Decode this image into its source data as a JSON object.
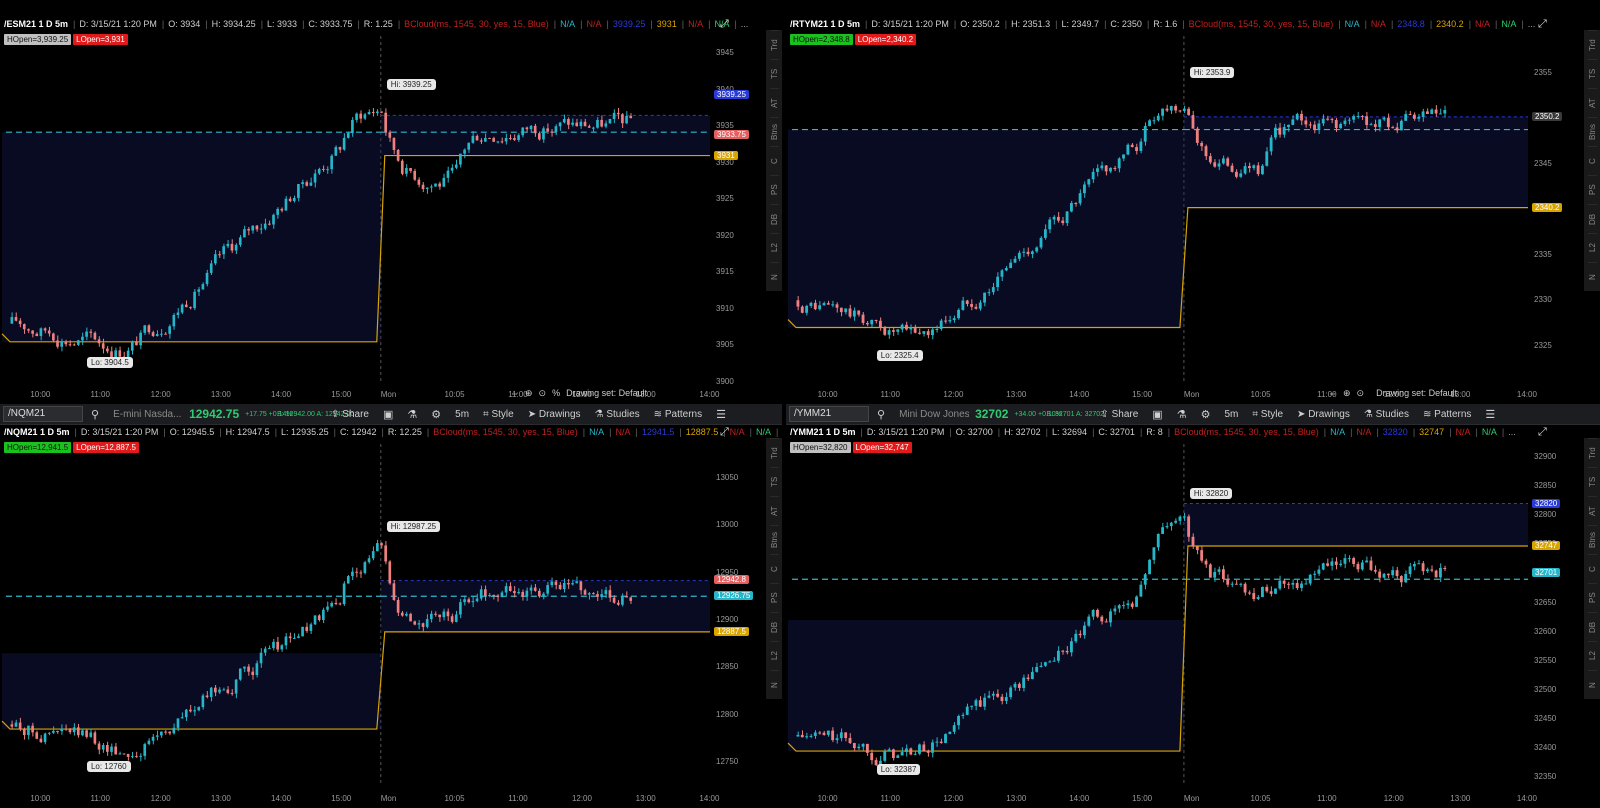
{
  "top_strip": {
    "color": "#ffffff"
  },
  "charts": [
    {
      "id": "es",
      "toolbar": null,
      "header": {
        "title": "/ESM21 1 D 5m",
        "date": "D: 3/15/21 1:20 PM",
        "o": "O: 3934",
        "h": "H: 3934.25",
        "l": "L: 3933",
        "c": "C: 3933.75",
        "r": "R: 1.25",
        "extra": [
          "BCloud(ms, 1545, 30, yes, 15, Blue)",
          "N/A",
          "N/A",
          "3939.25",
          "3931",
          "N/A",
          "N/A",
          "..."
        ]
      },
      "badges": [
        {
          "text": "HOpen=3,939.25",
          "bg": "#c0c0c0",
          "fg": "#111"
        },
        {
          "text": "LOpen=3,931",
          "bg": "#e01a1a",
          "fg": "#fff"
        }
      ],
      "y_labels": [
        "3945",
        "3940",
        "3935",
        "3930",
        "3925",
        "3920",
        "3915",
        "3910",
        "3905",
        "3900"
      ],
      "ymin": 3900,
      "ymax": 3946,
      "tags": [
        {
          "text": "3939.25",
          "value": 3939.25,
          "bg": "#2a3ad6"
        },
        {
          "text": "3933.75",
          "value": 3933.75,
          "bg": "#e46060"
        },
        {
          "text": "3931",
          "value": 3931,
          "bg": "#d8a400"
        }
      ],
      "x_labels": [
        "10:00",
        "11:00",
        "12:00",
        "13:00",
        "14:00",
        "15:00",
        "Mon",
        "10:05",
        "11:00",
        "12:00",
        "13:00",
        "14:00"
      ],
      "hi_label": "Hi: 3939.25",
      "lo_label": "Lo: 3904.5",
      "controls": {
        "drawing_set": "Drawing set: Default",
        "pct": "%"
      },
      "series": {
        "start": 3908,
        "hiVal": 3939.25,
        "loVal": 3904.5,
        "levels": {
          "dashA": 3936.5,
          "dashB": 3934.2,
          "gold": 3931,
          "goldPrev": 3905.5
        }
      }
    },
    {
      "id": "rty",
      "toolbar": null,
      "header": {
        "title": "/RTYM21 1 D 5m",
        "date": "D: 3/15/21 1:20 PM",
        "o": "O: 2350.2",
        "h": "H: 2351.3",
        "l": "L: 2349.7",
        "c": "C: 2350",
        "r": "R: 1.6",
        "extra": [
          "BCloud(ms, 1545, 30, yes, 15, Blue)",
          "N/A",
          "N/A",
          "2348.8",
          "2340.2",
          "N/A",
          "N/A",
          "..."
        ]
      },
      "badges": [
        {
          "text": "HOpen=2,348.8",
          "bg": "#19c21c",
          "fg": "#111"
        },
        {
          "text": "LOpen=2,340.2",
          "bg": "#e01a1a",
          "fg": "#fff"
        }
      ],
      "y_labels": [
        "2355",
        "2350",
        "2345",
        "2340",
        "2335",
        "2330",
        "2325"
      ],
      "ymin": 2321,
      "ymax": 2358,
      "tags": [
        {
          "text": "2350.2",
          "value": 2350.2,
          "bg": "#3a3a3a"
        },
        {
          "text": "2340.2",
          "value": 2340.2,
          "bg": "#d8a400"
        }
      ],
      "x_labels": [
        "10:00",
        "11:00",
        "12:00",
        "13:00",
        "14:00",
        "15:00",
        "Mon",
        "10:05",
        "11:00",
        "12:00",
        "13:00",
        "14:00"
      ],
      "hi_label": "Hi: 2353.9",
      "lo_label": "Lo: 2325.4",
      "controls": {
        "drawing_set": "Drawing set: Default",
        "pct": ""
      },
      "series": {
        "start": 2330,
        "hiVal": 2353.9,
        "loVal": 2325.4,
        "levels": {
          "dashA": 2350.2,
          "dashB": 2348.8,
          "gold": 2340.2,
          "goldPrev": 2327
        }
      }
    },
    {
      "id": "nq",
      "toolbar": {
        "symbol": "/NQM21",
        "desc": "E-mini Nasda...",
        "price": "12942.75",
        "chg": "+17.75 +0.14%",
        "bidask": "B: 12942.00 A: 12942.00",
        "share": "Share",
        "interval": "5m",
        "style": "Style",
        "drawings": "Drawings",
        "studies": "Studies",
        "patterns": "Patterns"
      },
      "header": {
        "title": "/NQM21 1 D 5m",
        "date": "D: 3/15/21 1:20 PM",
        "o": "O: 12945.5",
        "h": "H: 12947.5",
        "l": "L: 12935.25",
        "c": "C: 12942",
        "r": "R: 12.25",
        "extra": [
          "BCloud(ms, 1545, 30, yes, 15, Blue)",
          "N/A",
          "N/A",
          "12941.5",
          "12887.5",
          "N/A",
          "N/A",
          "..."
        ]
      },
      "badges": [
        {
          "text": "HOpen=12,941.5",
          "bg": "#19c21c",
          "fg": "#111"
        },
        {
          "text": "LOpen=12,887.5",
          "bg": "#e01a1a",
          "fg": "#fff"
        }
      ],
      "y_labels": [
        "13050",
        "13000",
        "12950",
        "12900",
        "12850",
        "12800",
        "12750"
      ],
      "ymin": 12725,
      "ymax": 13075,
      "tags": [
        {
          "text": "12942.8",
          "value": 12942,
          "bg": "#e46060"
        },
        {
          "text": "12926.75",
          "value": 12925,
          "bg": "#27b6c9"
        },
        {
          "text": "12887.5",
          "value": 12887.5,
          "bg": "#d8a400"
        }
      ],
      "x_labels": [
        "10:00",
        "11:00",
        "12:00",
        "13:00",
        "14:00",
        "15:00",
        "Mon",
        "10:05",
        "11:00",
        "12:00",
        "13:00",
        "14:00"
      ],
      "hi_label": "Hi: 12987.25",
      "lo_label": "Lo: 12760",
      "controls": null,
      "series": {
        "start": 12790,
        "hiVal": 12987.25,
        "loVal": 12760,
        "levels": {
          "dashA": 12941.5,
          "dashB": 12925,
          "gold": 12887.5,
          "goldPrev": 12785
        }
      }
    },
    {
      "id": "ym",
      "toolbar": {
        "symbol": "/YMM21",
        "desc": "Mini Dow Jones Ind...",
        "price": "32702",
        "chg": "+34.00 +0.10%",
        "bidask": "B: 32701 A: 32702",
        "share": "Share",
        "interval": "5m",
        "style": "Style",
        "drawings": "Drawings",
        "studies": "Studies",
        "patterns": "Patterns"
      },
      "header": {
        "title": "/YMM21 1 D 5m",
        "date": "D: 3/15/21 1:20 PM",
        "o": "O: 32700",
        "h": "H: 32702",
        "l": "L: 32694",
        "c": "C: 32701",
        "r": "R: 8",
        "extra": [
          "BCloud(ms, 1545, 30, yes, 15, Blue)",
          "N/A",
          "N/A",
          "32820",
          "32747",
          "N/A",
          "N/A",
          "..."
        ]
      },
      "badges": [
        {
          "text": "HOpen=32,820",
          "bg": "#c0c0c0",
          "fg": "#111"
        },
        {
          "text": "LOpen=32,747",
          "bg": "#e01a1a",
          "fg": "#fff"
        }
      ],
      "y_labels": [
        "32900",
        "32850",
        "32800",
        "32750",
        "32700",
        "32650",
        "32600",
        "32550",
        "32500",
        "32450",
        "32400",
        "32350"
      ],
      "ymin": 32335,
      "ymax": 32905,
      "tags": [
        {
          "text": "32820",
          "value": 32820,
          "bg": "#2a3ad6"
        },
        {
          "text": "32747",
          "value": 32747,
          "bg": "#d8a400"
        },
        {
          "text": "32701",
          "value": 32701,
          "bg": "#27b6c9"
        }
      ],
      "x_labels": [
        "10:00",
        "11:00",
        "12:00",
        "13:00",
        "14:00",
        "15:00",
        "Mon",
        "10:05",
        "11:00",
        "12:00",
        "13:00",
        "14:00"
      ],
      "hi_label": "Hi: 32820",
      "lo_label": "Lo: 32387",
      "controls": null,
      "series": {
        "start": 32420,
        "hiVal": 32820,
        "loVal": 32387,
        "levels": {
          "dashA": 32820,
          "dashB": 32690,
          "gold": 32747,
          "goldPrev": 32395
        }
      }
    }
  ],
  "side_tabs": [
    "Trd",
    "TS",
    "AT",
    "Btns",
    "C",
    "PS",
    "DB",
    "L2",
    "N"
  ],
  "colors": {
    "up": "#27b6c9",
    "down": "#f08080",
    "gold": "#d8a400",
    "dash": "#2fb7cc",
    "cloud": "rgba(20,30,90,0.38)"
  }
}
